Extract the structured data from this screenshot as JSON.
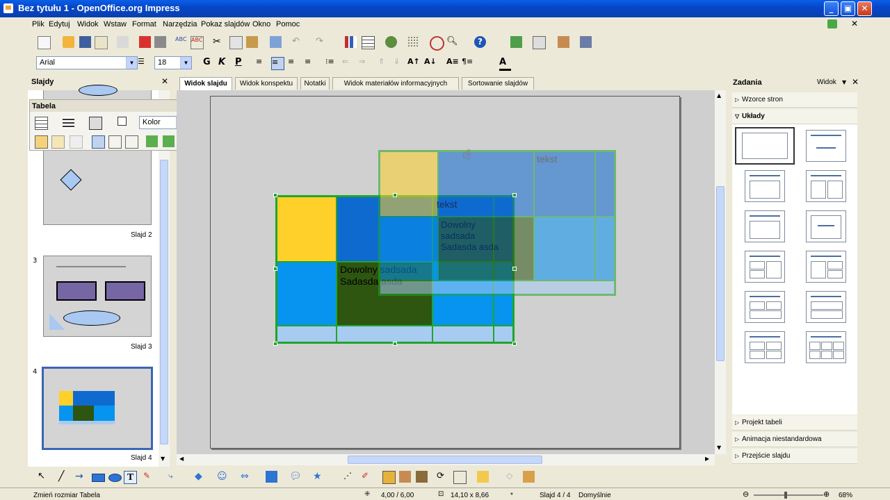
{
  "window": {
    "title": "Bez tytułu 1 - OpenOffice.org Impress"
  },
  "menu": [
    "Plik",
    "Edytuj",
    "Widok",
    "Wstaw",
    "Format",
    "Narzędzia",
    "Pokaz slajdów",
    "Okno",
    "Pomoc"
  ],
  "format_bar": {
    "font": "Arial",
    "size": "18",
    "bold": "G",
    "italic": "K",
    "underline": "P"
  },
  "slides_panel": {
    "title": "Slajdy",
    "slides": [
      {
        "number": "",
        "label": "Slajd 2"
      },
      {
        "number": "3",
        "label": "Slajd 3"
      },
      {
        "number": "4",
        "label": "Slajd 4"
      }
    ]
  },
  "table_toolbar": {
    "title": "Tabela",
    "area_style": "Kolor",
    "area_color": "Lazurowy"
  },
  "view_tabs": [
    "Widok slajdu",
    "Widok konspektu",
    "Notatki",
    "Widok materiałów informacyjnych",
    "Sortowanie slajdów"
  ],
  "slide": {
    "ghost_text": "tekst",
    "cell_text": "Dowolny sadsada Sadasda asda"
  },
  "tasks_panel": {
    "title": "Zadania",
    "view_label": "Widok",
    "sections": [
      "Wzorce stron",
      "Układy"
    ],
    "bottom_sections": [
      "Projekt tabeli",
      "Animacja niestandardowa",
      "Przejście slajdu"
    ]
  },
  "status_bar": {
    "action": "Zmień rozmiar Tabela",
    "position": "4,00 / 6,00",
    "size": "14,10 x 8,66",
    "modified": "*",
    "slide": "Slajd 4 / 4",
    "master": "Domyślnie",
    "zoom": "68%"
  },
  "colors": {
    "accent": "#0A5FE8",
    "yellow": "#FFD02A",
    "blue": "#0F6AD0",
    "light_blue": "#0694F0",
    "dark_green": "#2E5611",
    "pale_blue": "#A8CBF2",
    "border_green": "#1FA62A"
  }
}
